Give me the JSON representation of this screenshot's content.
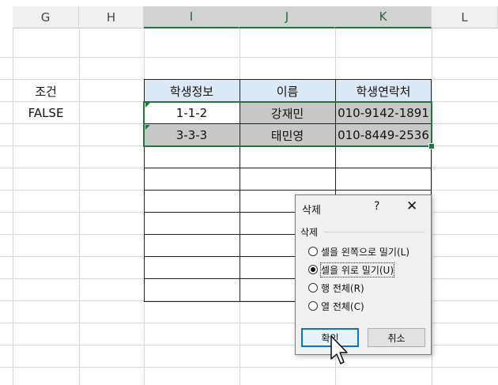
{
  "columns": [
    "G",
    "H",
    "I",
    "J",
    "K",
    "L"
  ],
  "labels": {
    "condition_title": "조건",
    "condition_value": "FALSE"
  },
  "table": {
    "headers": [
      "학생정보",
      "이름",
      "학생연락처"
    ],
    "rows": [
      [
        "1-1-2",
        "강재민",
        "010-9142-1891"
      ],
      [
        "3-3-3",
        "태민영",
        "010-8449-2536"
      ]
    ]
  },
  "dialog": {
    "title": "삭제",
    "help": "?",
    "close": "✕",
    "group_label": "삭제",
    "options": [
      {
        "label": "셀을 왼쪽으로 밀기(L)",
        "selected": false
      },
      {
        "label": "셀을 위로 밀기(U)",
        "selected": true
      },
      {
        "label": "행 전체(R)",
        "selected": false
      },
      {
        "label": "열 전체(C)",
        "selected": false
      }
    ],
    "ok_label": "확인",
    "cancel_label": "취소"
  }
}
